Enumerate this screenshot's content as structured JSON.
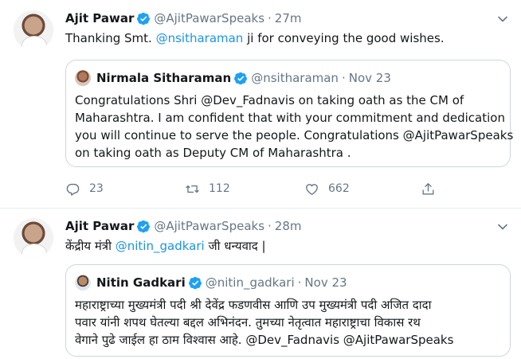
{
  "tweets": [
    {
      "author": "Ajit Pawar",
      "handle": "@AjitPawarSpeaks",
      "separator": "·",
      "time": "27m",
      "text_before": "Thanking Smt. ",
      "text_mention": "@nsitharaman",
      "text_after": " ji for conveying the good wishes.",
      "quote": {
        "author": "Nirmala Sitharaman",
        "handle": "@nsitharaman",
        "separator": "·",
        "time": "Nov 23",
        "lines": [
          "Congratulations Shri @Dev_Fadnavis on taking oath as the CM of",
          "Maharashtra. I am confident that with your commitment and dedication",
          "you will continue to serve the people. Congratulations @AjitPawarSpeaks",
          "on taking oath as Deputy CM of Maharashtra ."
        ]
      },
      "actions": {
        "replies": "23",
        "retweets": "112",
        "likes": "662"
      }
    },
    {
      "author": "Ajit Pawar",
      "handle": "@AjitPawarSpeaks",
      "separator": "·",
      "time": "28m",
      "text_before": "केंद्रीय मंत्री ",
      "text_mention": "@nitin_gadkari",
      "text_after": " जी धन्यवाद |",
      "quote": {
        "author": "Nitin Gadkari",
        "handle": "@nitin_gadkari",
        "separator": "·",
        "time": "Nov 23",
        "lines": [
          "महाराष्ट्राच्या मुख्यमंत्री पदी श्री देवेंद्र फडणवीस आणि उप मुख्यमंत्री पदी अजित दादा",
          "पवार यांनी शपथ घेतल्या बद्दल अभिनंदन. तुमच्या नेतृत्वात महाराष्ट्राचा विकास रथ",
          "वेगाने पुढे जाईल हा ठाम विश्वास आहे. @Dev_Fadnavis @AjitPawarSpeaks"
        ]
      }
    }
  ],
  "colors": {
    "link": "#1b95e0",
    "verified": "#1da1f2",
    "muted": "#657786",
    "border": "#ccd6dd"
  },
  "icons": [
    "verified-badge-icon",
    "chevron-down-icon",
    "reply-icon",
    "retweet-icon",
    "like-icon",
    "share-icon"
  ]
}
